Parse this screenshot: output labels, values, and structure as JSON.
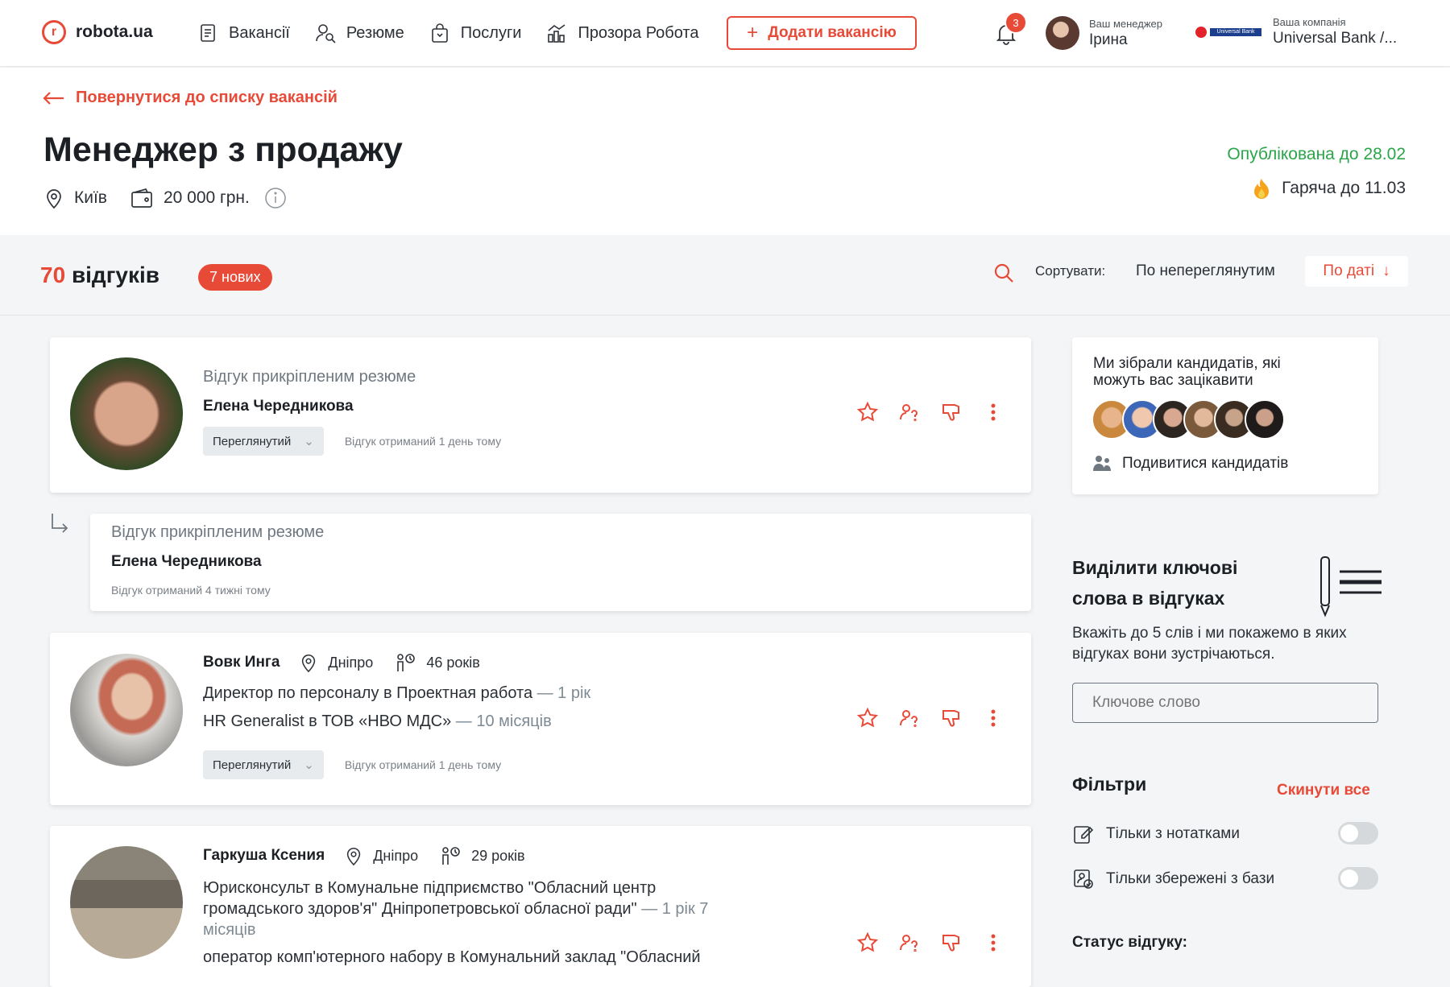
{
  "brand": {
    "name": "robota.ua",
    "logo_letter": "r"
  },
  "nav": [
    {
      "label": "Вакансії",
      "icon": "document-icon"
    },
    {
      "label": "Резюме",
      "icon": "person-search-icon"
    },
    {
      "label": "Послуги",
      "icon": "shopping-bag-icon"
    },
    {
      "label": "Прозора Робота",
      "icon": "chart-building-icon"
    }
  ],
  "add_vacancy": "Додати вакансію",
  "notifications_count": "3",
  "manager": {
    "caption": "Ваш менеджер",
    "name": "Ірина"
  },
  "company": {
    "caption": "Ваша компанія",
    "name": "Universal Bank /...",
    "logo_text": "Universal Bank"
  },
  "back_link": "Повернутися до списку вакансій",
  "vacancy": {
    "title": "Менеджер з продажу",
    "city": "Київ",
    "salary": "20 000 грн.",
    "published": "Опублікована до 28.02",
    "hot": "Гаряча до 11.03"
  },
  "responses": {
    "count": "70",
    "count_label": "відгуків",
    "new": "7 нових",
    "sort_label": "Сортувати:",
    "sort_unseen": "По непереглянутим",
    "sort_date": "По даті"
  },
  "cards": [
    {
      "type": "Відгук прикріпленим резюме",
      "name": "Елена Чередникова",
      "status": "Переглянутий",
      "received": "Відгук отриманий 1 день тому"
    },
    {
      "type": "Відгук прикріпленим резюме",
      "name": "Елена Чередникова",
      "received": "Відгук отриманий 4 тижні тому"
    },
    {
      "name": "Вовк Инга",
      "city": "Дніпро",
      "age": "46 років",
      "jobs": [
        {
          "text": "Директор по персоналу в Проектная работа",
          "dur": "— 1 рік"
        },
        {
          "text": "HR Generalist в ТОВ «НВО МДС»",
          "dur": "— 10 місяців"
        }
      ],
      "status": "Переглянутий",
      "received": "Відгук отриманий 1 день тому"
    },
    {
      "name": "Гаркуша Ксения",
      "city": "Дніпро",
      "age": "29 років",
      "jobs": [
        {
          "text": "Юрисконсульт в Комунальне підприємство \"Обласний центр громадського здоров'я\" Дніпропетровської обласної ради\"",
          "dur": "— 1 рік 7 місяців"
        },
        {
          "text": "оператор комп'ютерного набору в Комунальний заклад \"Обласний",
          "dur": ""
        }
      ]
    }
  ],
  "suggest": {
    "title": "Ми зібрали кандидатів, які можуть вас зацікавити",
    "link": "Подивитися кандидатів"
  },
  "keywords": {
    "title": "Виділити ключові слова в відгуках",
    "desc": "Вкажіть до 5 слів і ми покажемо в яких відгуках вони зустрічаються.",
    "placeholder": "Ключове слово"
  },
  "filters": {
    "title": "Фільтри",
    "reset": "Скинути все",
    "only_notes": "Тільки з нотатками",
    "only_saved": "Тільки збережені з бази",
    "status_title": "Статус відгуку:"
  },
  "colors": {
    "accent": "#e84a38",
    "green": "#2aa54a"
  }
}
